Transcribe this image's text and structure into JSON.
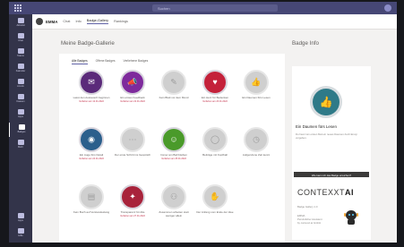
{
  "teams": {
    "search_placeholder": "Suchen",
    "rail": [
      {
        "label": "Aktivität",
        "icon": "bell-icon"
      },
      {
        "label": "Chat",
        "icon": "chat-icon"
      },
      {
        "label": "Teams",
        "icon": "teams-icon"
      },
      {
        "label": "Kalender",
        "icon": "calendar-icon"
      },
      {
        "label": "Anrufe",
        "icon": "phone-icon"
      },
      {
        "label": "Dateien",
        "icon": "files-icon"
      },
      {
        "label": "Apps",
        "icon": "apps-icon"
      },
      {
        "label": "Badges",
        "icon": "badge-icon"
      },
      {
        "label": "Mehr",
        "icon": "more-icon"
      },
      {
        "label": "Apps",
        "icon": "store-icon"
      },
      {
        "label": "Hilfe",
        "icon": "help-icon"
      }
    ]
  },
  "app": {
    "name": "EMMA",
    "tabs": [
      "Chat",
      "Info",
      "Badge-Gallery",
      "Rankings"
    ],
    "active_tab": "Badge-Gallery"
  },
  "gallery": {
    "title": "Meine Badge-Gallerie",
    "filters": [
      "Alle Badges",
      "Offene Badges",
      "Verliehene Badges"
    ],
    "badges": [
      {
        "name": "Lasst den Austausch beginnen",
        "date": "Verliehen am 12.01.2022",
        "color": "#5b2a7a",
        "icon": "chat-bubble-icon",
        "glyph": "✉",
        "earned": true
      },
      {
        "name": "Ein erstes Feedback",
        "date": "Verliehen am 22.01.2022",
        "color": "#7e2a9c",
        "icon": "megaphone-icon",
        "glyph": "📣",
        "earned": true
      },
      {
        "name": "Kein Blatt vor dem Mund",
        "date": "",
        "color": "#cfcfcf",
        "icon": "speech-icon",
        "glyph": "✎",
        "earned": false
      },
      {
        "name": "Ein Herz für Bedenken",
        "date": "Verliehen am 23.01.2022",
        "color": "#c4213a",
        "icon": "heart-icon",
        "glyph": "♥",
        "earned": true
      },
      {
        "name": "Ein Daumen fürs Lesen",
        "date": "",
        "color": "#cfcfcf",
        "icon": "thumb-up-icon",
        "glyph": "👍",
        "earned": false
      },
      {
        "name": "Ein Auge fürs Detail",
        "date": "Verliehen am 24.01.2022",
        "color": "#2b5f8c",
        "icon": "eye-icon",
        "glyph": "◉",
        "earned": true
      },
      {
        "name": "Der erste Schritt ins Gespräch",
        "date": "",
        "color": "#cfcfcf",
        "icon": "footsteps-icon",
        "glyph": "⋯",
        "earned": false
      },
      {
        "name": "Immer am Ball bleiben",
        "date": "Verliehen am 25.01.2022",
        "color": "#4a9a2a",
        "icon": "person-icon",
        "glyph": "☺",
        "earned": true
      },
      {
        "name": "Beiträge mit Kopfball",
        "date": "",
        "color": "#cfcfcf",
        "icon": "ball-icon",
        "glyph": "◯",
        "earned": false
      },
      {
        "name": "Aufgerufene Zeit kennt",
        "date": "",
        "color": "#cfcfcf",
        "icon": "clock-icon",
        "glyph": "◷",
        "earned": false
      },
      {
        "name": "Kein Buch auf Verstandeslang",
        "date": "",
        "color": "#cfcfcf",
        "icon": "book-icon",
        "glyph": "▤",
        "earned": false
      },
      {
        "name": "Transparenz für Alle",
        "date": "Verliehen am 27.01.2022",
        "color": "#a8233b",
        "icon": "gift-icon",
        "glyph": "✦",
        "earned": true
      },
      {
        "name": "Zusammen arbeiten statt weniger allein",
        "date": "",
        "color": "#cfcfcf",
        "icon": "people-icon",
        "glyph": "⚇",
        "earned": false
      },
      {
        "name": "Der Anfang vom Ende der Idee",
        "date": "",
        "color": "#cfcfcf",
        "icon": "hands-icon",
        "glyph": "✋",
        "earned": false
      }
    ]
  },
  "info": {
    "title": "Badge Info",
    "badge_name": "Ein Daumen fürs Lesen",
    "badge_icon": "thumb-up-icon",
    "description": "Du hast zum ersten Mal ein neues Daumen-hoch Emoji vergeben.",
    "button": "Wie kann ich das Badge erreichen?"
  },
  "brand": {
    "logo_text": "CONTEXXT",
    "logo_suffix": "AI",
    "lines": [
      "Badge Gallery 1.0",
      "EMMA",
      "Persönlicher Assistent",
      "by contexxt.ai GmbH"
    ]
  }
}
